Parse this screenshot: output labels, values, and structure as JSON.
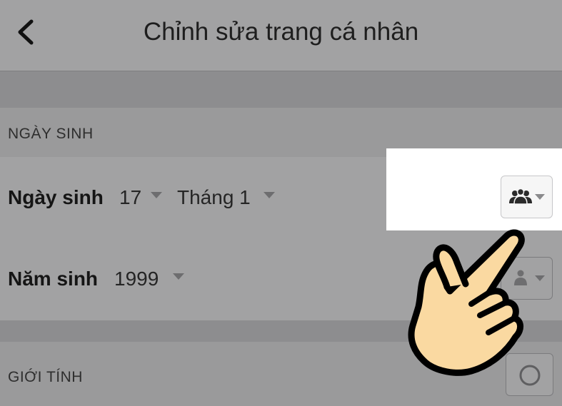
{
  "header": {
    "title": "Chỉnh sửa trang cá nhân",
    "back_icon": "chevron-left-icon"
  },
  "birthday_section": {
    "heading": "NGÀY SINH",
    "date_row": {
      "label": "Ngày sinh",
      "day": "17",
      "month": "Tháng 1",
      "audience_icon": "people-icon"
    },
    "year_row": {
      "label": "Năm sinh",
      "year": "1999",
      "audience_icon": "people-icon"
    }
  },
  "gender_section": {
    "heading": "GIỚI TÍNH",
    "option_icon": "radio-circle-icon"
  },
  "overlay": {
    "pointer_icon": "pointing-hand-icon"
  },
  "colors": {
    "header_bg": "#a2a2a3",
    "row_bg": "#a2a2a3",
    "section_bg": "#9a9a9b",
    "divider_bg": "#8d8d8f",
    "highlight_bg": "#ffffff",
    "hand_fill": "#fad9a1"
  }
}
